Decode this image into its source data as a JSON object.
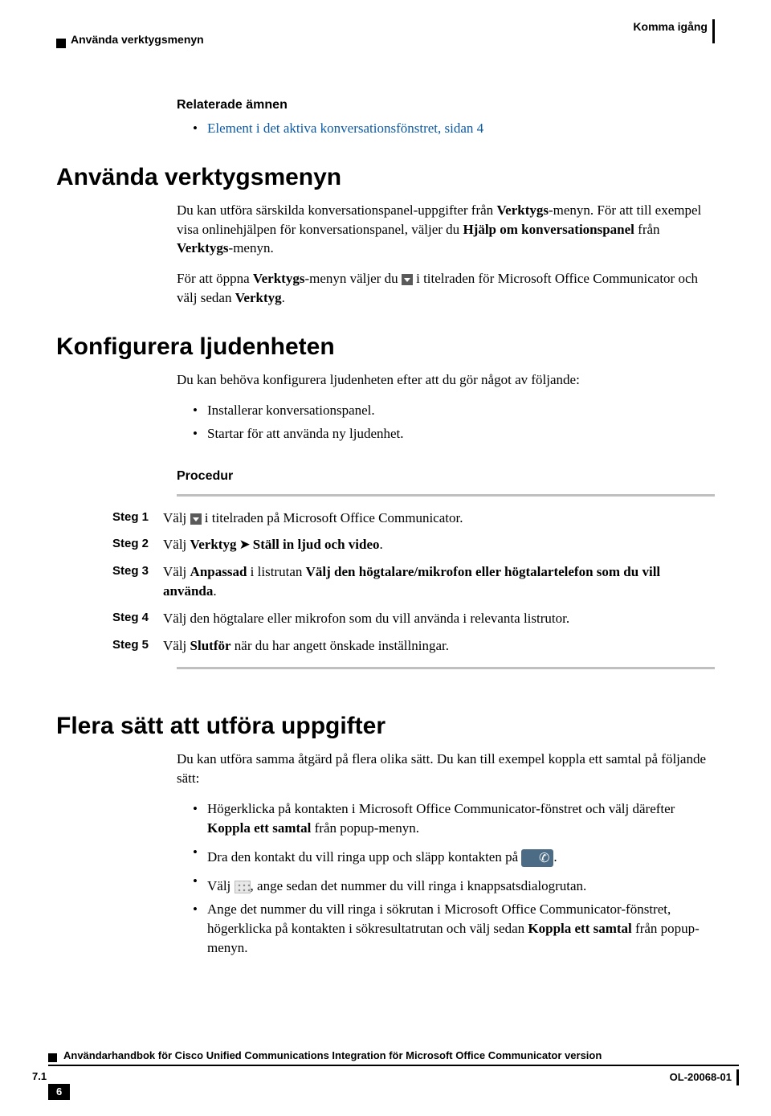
{
  "header": {
    "left": "Använda verktygsmenyn",
    "right": "Komma igång"
  },
  "related": {
    "title": "Relaterade ämnen",
    "link": "Element i det aktiva konversationsfönstret,  sidan 4"
  },
  "section1": {
    "heading": "Använda verktygsmenyn",
    "p1a": "Du kan utföra särskilda konversationspanel-uppgifter från ",
    "p1b": "Verktygs",
    "p1c": "-menyn. För att till exempel visa onlinehjälpen för konversationspanel, väljer du ",
    "p1d": "Hjälp om konversationspanel",
    "p1e": " från ",
    "p1f": "Verktygs",
    "p1g": "-menyn.",
    "p2a": "För att öppna ",
    "p2b": "Verktygs",
    "p2c": "-menyn väljer du ",
    "p2d": " i titelraden för Microsoft Office Communicator och välj sedan ",
    "p2e": "Verktyg",
    "p2f": "."
  },
  "section2": {
    "heading": "Konfigurera ljudenheten",
    "intro": "Du kan behöva konfigurera ljudenheten efter att du gör något av följande:",
    "b1": "Installerar konversationspanel.",
    "b2": "Startar för att använda ny ljudenhet.",
    "procedure": "Procedur",
    "steps": {
      "s1_label": "Steg 1",
      "s1a": "Välj ",
      "s1b": " i titelraden på Microsoft Office Communicator.",
      "s2_label": "Steg 2",
      "s2a": "Välj ",
      "s2b": "Verktyg",
      "s2c": "Ställ in ljud och video",
      "s2d": ".",
      "s3_label": "Steg 3",
      "s3a": "Välj ",
      "s3b": "Anpassad",
      "s3c": " i listrutan ",
      "s3d": "Välj den högtalare/mikrofon eller högtalartelefon som du vill använda",
      "s3e": ".",
      "s4_label": "Steg 4",
      "s4": "Välj den högtalare eller mikrofon som du vill använda i relevanta listrutor.",
      "s5_label": "Steg 5",
      "s5a": "Välj ",
      "s5b": "Slutför",
      "s5c": " när du har angett önskade inställningar."
    }
  },
  "section3": {
    "heading": "Flera sätt att utföra uppgifter",
    "intro": "Du kan utföra samma åtgärd på flera olika sätt. Du kan till exempel koppla ett samtal på följande sätt:",
    "b1a": "Högerklicka på kontakten i Microsoft Office Communicator-fönstret och välj därefter ",
    "b1b": "Koppla ett samtal",
    "b1c": " från popup-menyn.",
    "b2a": "Dra den kontakt du vill ringa upp och släpp kontakten på ",
    "b2b": ".",
    "b3a": "Välj ",
    "b3b": ", ange sedan det nummer du vill ringa i knappsatsdialogrutan.",
    "b4a": "Ange det nummer du vill ringa i sökrutan i Microsoft Office Communicator-fönstret, högerklicka på kontakten i sökresultatrutan och välj sedan ",
    "b4b": "Koppla ett samtal",
    "b4c": " från popup-menyn."
  },
  "footer": {
    "title": "Användarhandbok för Cisco Unified Communications Integration för Microsoft Office Communicator version",
    "version": "7.1",
    "page": "6",
    "doc": "OL-20068-01"
  }
}
